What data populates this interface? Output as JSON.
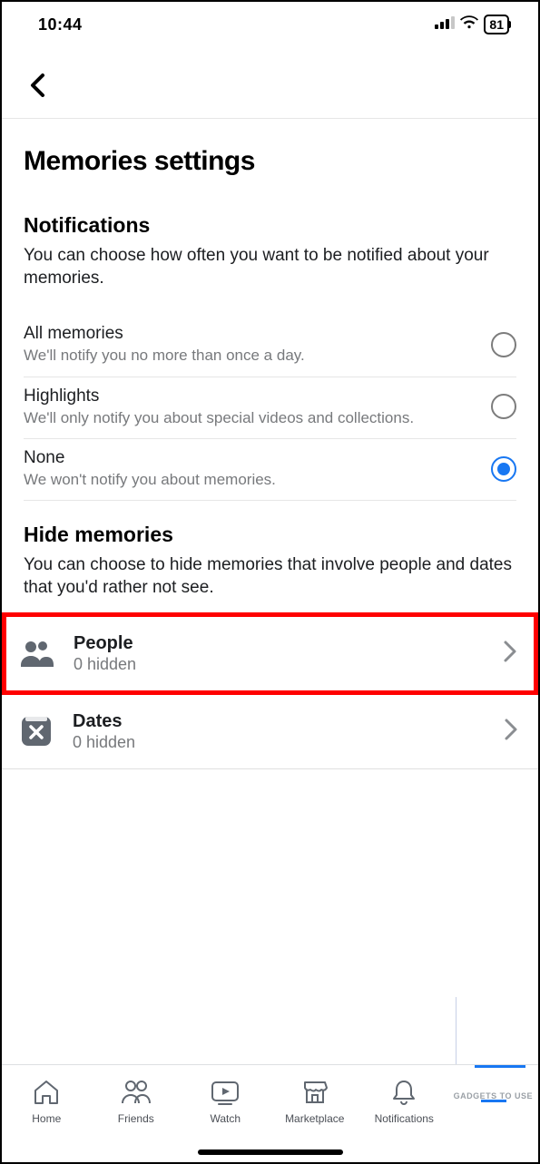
{
  "status": {
    "time": "10:44",
    "battery": "81"
  },
  "page": {
    "title": "Memories settings"
  },
  "notifications": {
    "heading": "Notifications",
    "desc": "You can choose how often you want to be notified about your memories.",
    "options": [
      {
        "title": "All memories",
        "sub": "We'll notify you no more than once a day.",
        "selected": false
      },
      {
        "title": "Highlights",
        "sub": "We'll only notify you about special videos and collections.",
        "selected": false
      },
      {
        "title": "None",
        "sub": "We won't notify you about memories.",
        "selected": true
      }
    ]
  },
  "hide": {
    "heading": "Hide memories",
    "desc": "You can choose to hide memories that involve people and dates that you'd rather not see.",
    "people": {
      "title": "People",
      "sub": "0 hidden"
    },
    "dates": {
      "title": "Dates",
      "sub": "0 hidden"
    }
  },
  "tabs": {
    "home": "Home",
    "friends": "Friends",
    "watch": "Watch",
    "marketplace": "Marketplace",
    "notifications": "Notifications"
  },
  "watermark": "GADGETS TO USE"
}
